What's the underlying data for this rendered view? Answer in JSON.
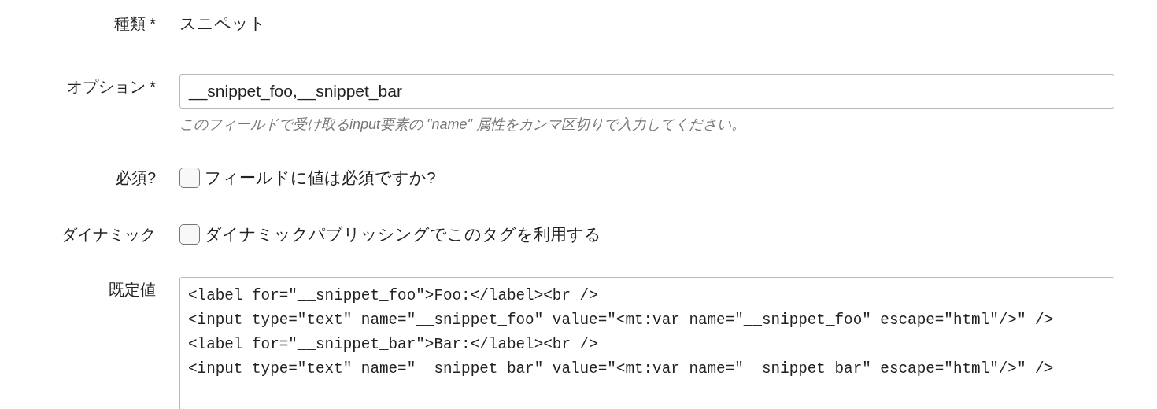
{
  "fields": [
    {
      "kind": "text",
      "label": "種類 *",
      "value": "スニペット"
    },
    {
      "kind": "input",
      "label": "オプション *",
      "value": "__snippet_foo,__snippet_bar",
      "hint": "このフィールドで受け取るinput要素の \"name\" 属性をカンマ区切りで入力してください。"
    },
    {
      "kind": "checkbox",
      "label": "必須?",
      "text": "フィールドに値は必須ですか?",
      "checked": false
    },
    {
      "kind": "checkbox",
      "label": "ダイナミック",
      "text": "ダイナミックパブリッシングでこのタグを利用する",
      "checked": false
    },
    {
      "kind": "textarea",
      "label": "既定値",
      "value": "<label for=\"__snippet_foo\">Foo:</label><br />\n<input type=\"text\" name=\"__snippet_foo\" value=\"<mt:var name=\"__snippet_foo\" escape=\"html\"/>\" />\n<label for=\"__snippet_bar\">Bar:</label><br />\n<input type=\"text\" name=\"__snippet_bar\" value=\"<mt:var name=\"__snippet_bar\" escape=\"html\"/>\" />"
    }
  ]
}
